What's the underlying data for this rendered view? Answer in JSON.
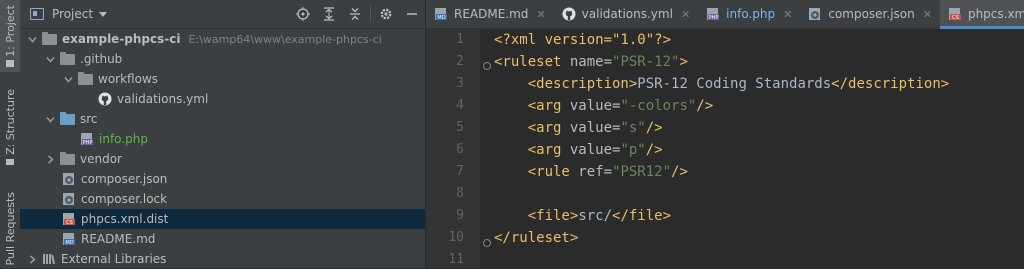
{
  "left_strip": {
    "tabs": [
      {
        "label": "1: Project"
      },
      {
        "label": "Z: Structure"
      },
      {
        "label": "Pull Requests"
      }
    ]
  },
  "project_panel": {
    "title": "Project",
    "tree": [
      {
        "label": "example-phpcs-ci",
        "path": "E:\\wamp64\\www\\example-phpcs-ci",
        "icon": "folder-icon"
      },
      {
        "label": ".github",
        "icon": "folder-icon"
      },
      {
        "label": "workflows",
        "icon": "folder-icon"
      },
      {
        "label": "validations.yml",
        "icon": "github-icon"
      },
      {
        "label": "src",
        "icon": "folder-icon"
      },
      {
        "label": "info.php",
        "icon": "php-file-icon"
      },
      {
        "label": "vendor",
        "icon": "folder-icon"
      },
      {
        "label": "composer.json",
        "icon": "composer-icon"
      },
      {
        "label": "composer.lock",
        "icon": "composer-icon"
      },
      {
        "label": "phpcs.xml.dist",
        "icon": "xml-file-icon"
      },
      {
        "label": "README.md",
        "icon": "markdown-file-icon"
      },
      {
        "label": "External Libraries",
        "icon": "library-icon"
      }
    ]
  },
  "editor": {
    "tabs": [
      {
        "label": "README.md",
        "icon": "markdown-file-icon"
      },
      {
        "label": "validations.yml",
        "icon": "github-icon"
      },
      {
        "label": "info.php",
        "icon": "php-file-icon"
      },
      {
        "label": "composer.json",
        "icon": "composer-icon"
      },
      {
        "label": "phpcs.xml.dist",
        "icon": "xml-file-icon",
        "active": true
      }
    ],
    "line_numbers": [
      "1",
      "2",
      "3",
      "4",
      "5",
      "6",
      "7",
      "8",
      "9",
      "10",
      "11"
    ],
    "lines": [
      [
        {
          "t": "<?xml version=\"1.0\"?>",
          "c": "pi"
        }
      ],
      [
        {
          "t": "<ruleset ",
          "c": "tag"
        },
        {
          "t": "name=",
          "c": "attr"
        },
        {
          "t": "\"PSR-12\"",
          "c": "val"
        },
        {
          "t": ">",
          "c": "tag"
        }
      ],
      [
        {
          "t": "    <description>",
          "c": "tag"
        },
        {
          "t": "PSR-12 Coding Standards",
          "c": "text"
        },
        {
          "t": "</description>",
          "c": "tag"
        }
      ],
      [
        {
          "t": "    <arg ",
          "c": "tag"
        },
        {
          "t": "value=",
          "c": "attr"
        },
        {
          "t": "\"-colors\"",
          "c": "val"
        },
        {
          "t": "/>",
          "c": "tag"
        }
      ],
      [
        {
          "t": "    <arg ",
          "c": "tag"
        },
        {
          "t": "value=",
          "c": "attr"
        },
        {
          "t": "\"s\"",
          "c": "val"
        },
        {
          "t": "/>",
          "c": "tag"
        }
      ],
      [
        {
          "t": "    <arg ",
          "c": "tag"
        },
        {
          "t": "value=",
          "c": "attr"
        },
        {
          "t": "\"p\"",
          "c": "val"
        },
        {
          "t": "/>",
          "c": "tag"
        }
      ],
      [
        {
          "t": "    <rule ",
          "c": "tag"
        },
        {
          "t": "ref=",
          "c": "attr"
        },
        {
          "t": "\"PSR12\"",
          "c": "val"
        },
        {
          "t": "/>",
          "c": "tag"
        }
      ],
      [],
      [
        {
          "t": "    <file>",
          "c": "tag"
        },
        {
          "t": "src/",
          "c": "text"
        },
        {
          "t": "</file>",
          "c": "tag"
        }
      ],
      [
        {
          "t": "</ruleset>",
          "c": "tag"
        }
      ],
      []
    ]
  },
  "colors": {
    "accent": "#4a88c7",
    "selection": "#0d293e",
    "xml_tag": "#e8bf6a",
    "xml_value": "#6a8759"
  }
}
